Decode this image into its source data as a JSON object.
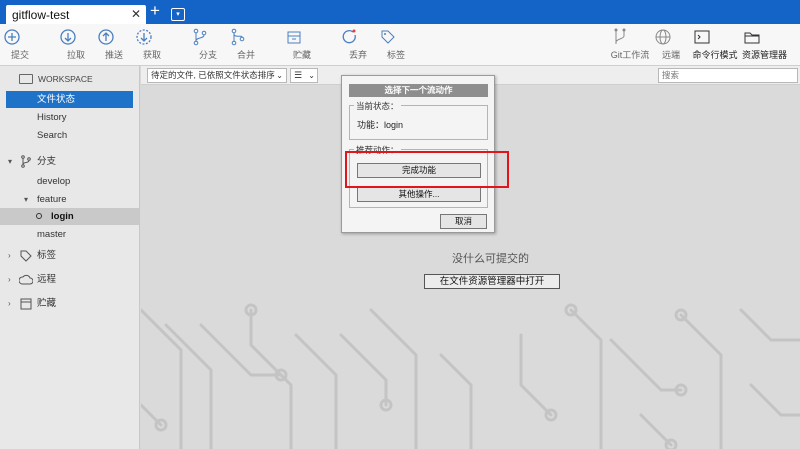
{
  "tab": {
    "title": "gitflow-test",
    "close": "✕",
    "add": "+",
    "menu": "▾"
  },
  "toolbar": {
    "commit": "提交",
    "pull": "拉取",
    "push": "推送",
    "fetch": "获取",
    "branch": "分支",
    "merge": "合并",
    "stash": "贮藏",
    "discard": "丢弃",
    "tag": "标签",
    "git_flow": "Git工作流",
    "remote": "远端",
    "terminal": "命令行模式",
    "explorer": "资源管理器"
  },
  "sidebar": {
    "workspace": "WORKSPACE",
    "file_status": "文件状态",
    "history": "History",
    "search": "Search",
    "branches": "分支",
    "develop": "develop",
    "feature": "feature",
    "login": "login",
    "master": "master",
    "tags": "标签",
    "remotes": "远程",
    "stashes": "贮藏"
  },
  "main": {
    "filter_value": "待定的文件, 已依照文件状态排序",
    "list_mode": "☰",
    "search_placeholder": "搜索",
    "empty_text": "没什么可提交的",
    "open_explorer": "在文件资源管理器中打开"
  },
  "dialog": {
    "title": "选择下一个流动作",
    "current_state_label": "当前状态：",
    "current_state": "功能：login",
    "suggested_label": "推荐动作：",
    "finish_feature": "完成功能",
    "other_actions": "其他操作...",
    "cancel": "取消"
  },
  "colors": {
    "accent": "#1464c8",
    "selection": "#1e73c8",
    "highlight": "#e0161b"
  }
}
